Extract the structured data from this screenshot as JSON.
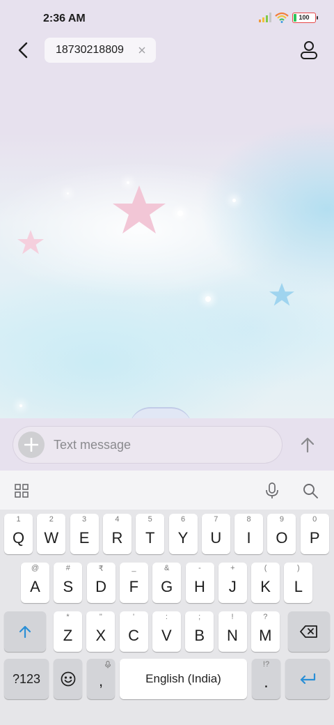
{
  "status_bar": {
    "time": "2:36 AM",
    "battery_level": "100"
  },
  "header": {
    "recipient": "18730218809"
  },
  "compose": {
    "placeholder": "Text message"
  },
  "keyboard": {
    "row1": [
      {
        "main": "Q",
        "hint": "1"
      },
      {
        "main": "W",
        "hint": "2"
      },
      {
        "main": "E",
        "hint": "3"
      },
      {
        "main": "R",
        "hint": "4"
      },
      {
        "main": "T",
        "hint": "5"
      },
      {
        "main": "Y",
        "hint": "6"
      },
      {
        "main": "U",
        "hint": "7"
      },
      {
        "main": "I",
        "hint": "8"
      },
      {
        "main": "O",
        "hint": "9"
      },
      {
        "main": "P",
        "hint": "0"
      }
    ],
    "row2": [
      {
        "main": "A",
        "hint": "@"
      },
      {
        "main": "S",
        "hint": "#"
      },
      {
        "main": "D",
        "hint": "₹"
      },
      {
        "main": "F",
        "hint": "_"
      },
      {
        "main": "G",
        "hint": "&"
      },
      {
        "main": "H",
        "hint": "-"
      },
      {
        "main": "J",
        "hint": "+"
      },
      {
        "main": "K",
        "hint": "("
      },
      {
        "main": "L",
        "hint": ")"
      }
    ],
    "row3": [
      {
        "main": "Z",
        "hint": "*"
      },
      {
        "main": "X",
        "hint": "\""
      },
      {
        "main": "C",
        "hint": "'"
      },
      {
        "main": "V",
        "hint": ":"
      },
      {
        "main": "B",
        "hint": ";"
      },
      {
        "main": "N",
        "hint": "!"
      },
      {
        "main": "M",
        "hint": "?"
      }
    ],
    "symbols_label": "?123",
    "comma_label": ",",
    "space_label": "English (India)",
    "period_label": ".",
    "period_hint": "!?"
  },
  "icons": {
    "back": "arrow-left-icon",
    "clear": "close-icon",
    "profile": "person-icon",
    "add": "plus-icon",
    "send": "arrow-up-icon",
    "apps": "grid-icon",
    "mic": "microphone-icon",
    "search": "search-icon",
    "shift": "shift-icon",
    "backspace": "backspace-icon",
    "emoji": "emoji-icon",
    "enter": "enter-icon"
  },
  "colors": {
    "accent": "#2a8fd6",
    "background": "#e7e1ee",
    "battery_outline": "#e64646",
    "battery_fill": "#2bc45a"
  }
}
